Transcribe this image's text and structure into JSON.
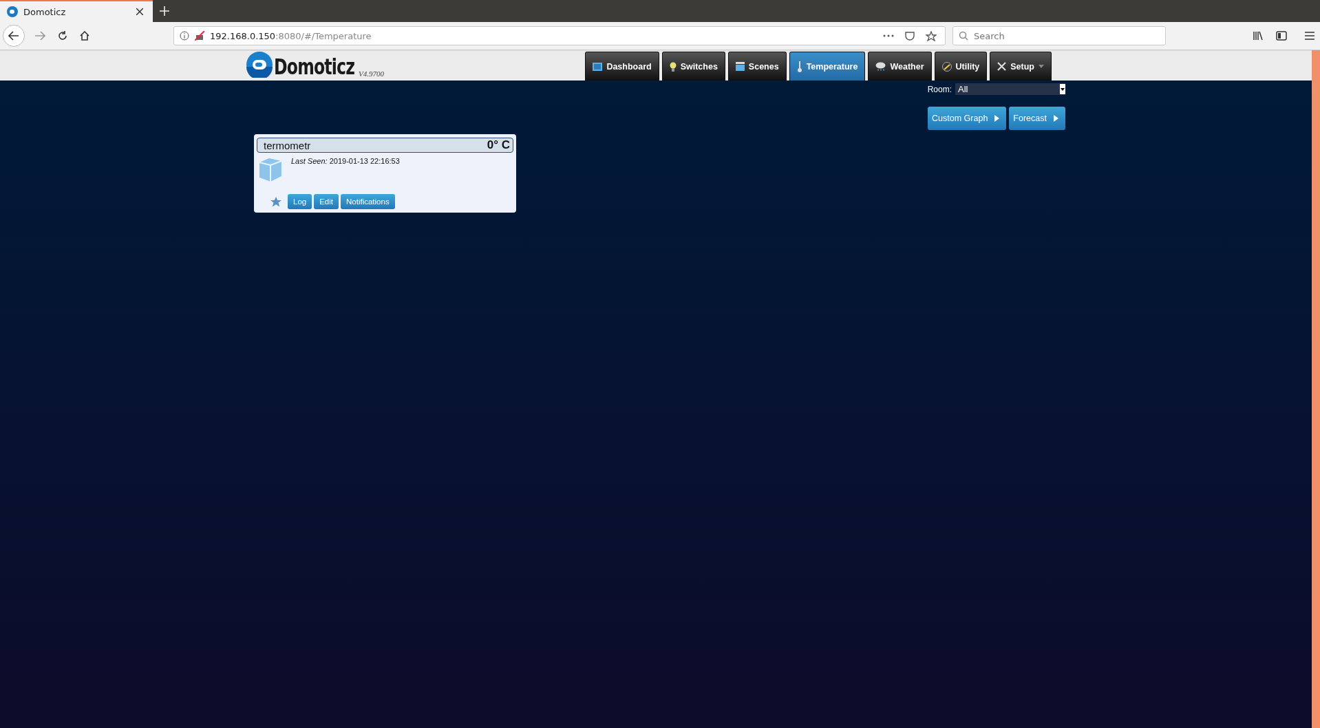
{
  "browser": {
    "tab_title": "Domoticz",
    "url_host": "192.168.0.150",
    "url_rest": ":8080/#/Temperature",
    "search_placeholder": "Search"
  },
  "header": {
    "logo_text": "Domoticz",
    "version": "V4.9700"
  },
  "nav": [
    {
      "label": "Dashboard",
      "selected": false,
      "has_menu": false
    },
    {
      "label": "Switches",
      "selected": false,
      "has_menu": false
    },
    {
      "label": "Scenes",
      "selected": false,
      "has_menu": false
    },
    {
      "label": "Temperature",
      "selected": true,
      "has_menu": false
    },
    {
      "label": "Weather",
      "selected": false,
      "has_menu": false
    },
    {
      "label": "Utility",
      "selected": false,
      "has_menu": false
    },
    {
      "label": "Setup",
      "selected": false,
      "has_menu": true
    }
  ],
  "room": {
    "label": "Room:",
    "value": "All"
  },
  "actions": [
    "Custom Graph",
    "Forecast"
  ],
  "devices": [
    {
      "name": "termometr",
      "reading": "0° C",
      "last_seen_label": "Last Seen:",
      "last_seen": "2019-01-13 22:16:53",
      "buttons": [
        "Log",
        "Edit",
        "Notifications"
      ]
    }
  ]
}
